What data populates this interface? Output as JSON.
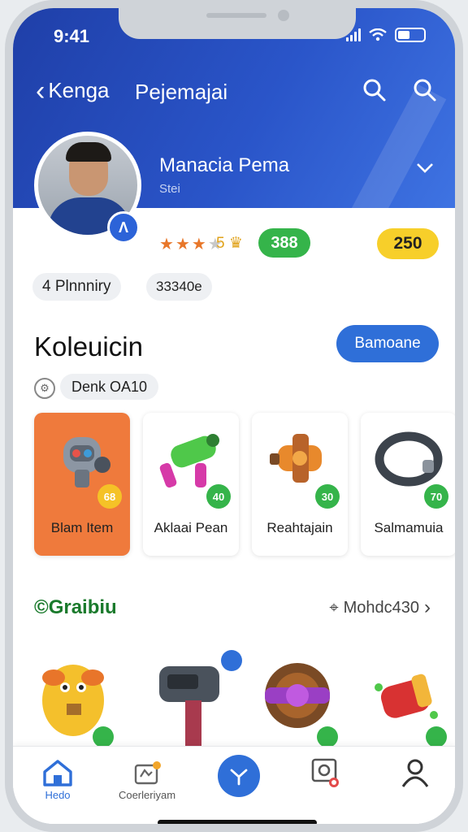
{
  "status": {
    "time": "9:41"
  },
  "topbar": {
    "back_label": "Kenga",
    "title": "Pejemajai"
  },
  "profile": {
    "name": "Manacia Pema",
    "subtitle": "Stei",
    "avatar_badge": "Λ"
  },
  "stats": {
    "stars_filled": 3,
    "stars_total": 4,
    "rating": "5",
    "green_value": "388",
    "yellow_value": "250"
  },
  "chips": {
    "a": "4 Plnnniry",
    "b": "33340e"
  },
  "collection": {
    "title": "Koleuicin",
    "button": "Bamoane",
    "filter": "Denk OA10",
    "items": [
      {
        "name": "Blam Item",
        "badge": "68"
      },
      {
        "name": "Aklaai Pean",
        "badge": "40"
      },
      {
        "name": "Reahtajain",
        "badge": "30"
      },
      {
        "name": "Salmamuia",
        "badge": "70"
      }
    ]
  },
  "section2": {
    "title": "Graibiu",
    "right_label": "Mohdc430"
  },
  "nav": {
    "home": "Hedo",
    "community": "Coerleriyam"
  },
  "colors": {
    "accent": "#2f6fd8",
    "green": "#35b44a",
    "yellow": "#f7cf2a",
    "orange": "#ef7a3c"
  }
}
